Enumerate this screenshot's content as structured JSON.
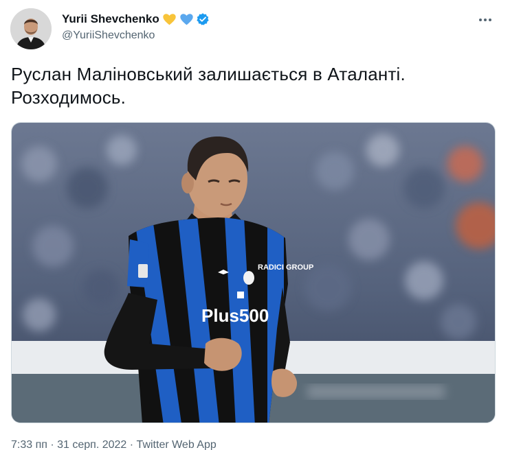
{
  "user": {
    "display_name": "Yurii Shevchenko",
    "handle": "@YuriiShevchenko",
    "emoji": [
      "yellow-heart",
      "blue-heart"
    ],
    "verified": true
  },
  "tweet": {
    "text_line_1": "Руслан Маліновський залишається в Аталанті.",
    "text_line_2": "Розходимось."
  },
  "photo": {
    "jersey_sponsor": "Plus500",
    "jersey_partner": "RADICI GROUP"
  },
  "meta": {
    "time": "7:33 пп",
    "separator": " · ",
    "date": "31 серп. 2022",
    "source": "Twitter Web App"
  },
  "colors": {
    "accent": "#1d9bf0",
    "secondary_text": "#536471",
    "jersey_blue": "#1f5fc4",
    "jersey_black": "#111111",
    "heart_yellow": "#f8c43a",
    "heart_blue": "#5ba8ee"
  }
}
